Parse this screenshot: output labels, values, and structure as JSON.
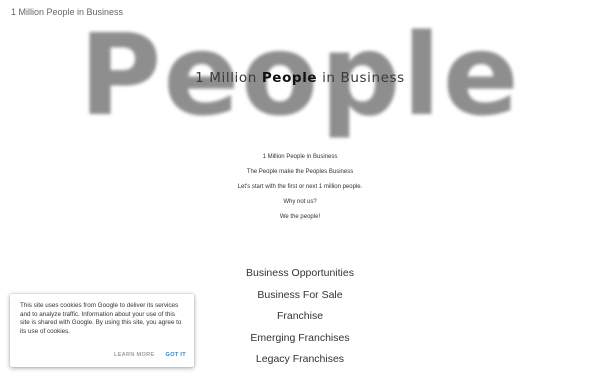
{
  "site": {
    "title": "1 Million People in Business"
  },
  "hero": {
    "background_word": "People",
    "headline_before": "1 Million ",
    "headline_bold": "People",
    "headline_after": " in Business"
  },
  "intro": {
    "lines": [
      "1 Million People in Business",
      "The People make the Peoples Business",
      "Let's start with the first or next 1 million people.",
      "Why not us?",
      "We the people!"
    ]
  },
  "nav": {
    "links": [
      "Business Opportunities",
      "Business For Sale",
      "Franchise",
      "Emerging Franchises",
      "Legacy Franchises"
    ]
  },
  "cookie": {
    "message": "This site uses cookies from Google to deliver its services and to analyze traffic. Information about your use of this site is shared with Google. By using this site, you agree to its use of cookies.",
    "learn_more_label": "LEARN MORE",
    "got_it_label": "GOT IT",
    "accent_color": "#1e88e5"
  }
}
